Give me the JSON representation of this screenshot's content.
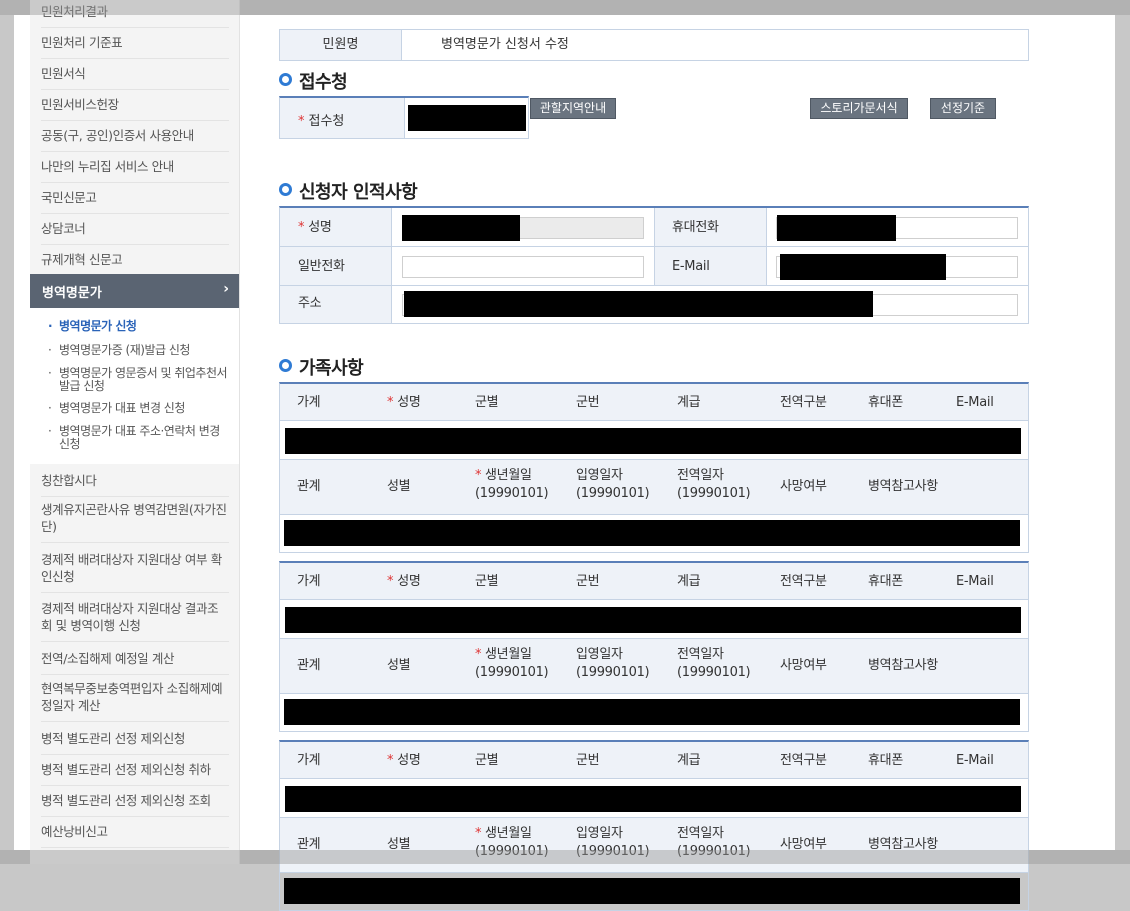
{
  "sidebar": {
    "items_top": [
      "민원처리결과",
      "민원처리 기준표",
      "민원서식",
      "민원서비스헌장",
      "공동(구, 공인)인증서 사용안내",
      "나만의 누리집 서비스 안내",
      "국민신문고",
      "상담코너",
      "규제개혁 신문고"
    ],
    "active": "병역명문가",
    "sub": [
      "병역명문가 신청",
      "병역명문가증 (재)발급 신청",
      "병역명문가 영문증서 및 취업추천서 발급 신청",
      "병역명문가 대표 변경 신청",
      "병역명문가 대표 주소·연락처 변경 신청"
    ],
    "items_bottom": [
      "칭찬합시다",
      "생계유지곤란사유 병역감면원(자가진단)",
      "경제적 배려대상자 지원대상 여부 확인신청",
      "경제적 배려대상자 지원대상 결과조회 및 병역이행 신청",
      "전역/소집해제 예정일 계산",
      "현역복무중보충역편입자 소집해제예정일자 계산",
      "병적 별도관리 선정 제외신청",
      "병적 별도관리 선정 제외신청 취하",
      "병적 별도관리 선정 제외신청 조회",
      "예산낭비신고"
    ]
  },
  "form": {
    "name_label": "민원명",
    "name_value": "병역명문가 신청서 수정",
    "receiver_title": "접수청",
    "receiver_label": "접수청",
    "btn_area": "관할지역안내",
    "btn_story": "스토리가문서식",
    "btn_criteria": "선정기준",
    "applicant_title": "신청자 인적사항",
    "lbl_name": "성명",
    "lbl_mobile": "휴대전화",
    "lbl_phone": "일반전화",
    "lbl_email": "E-Mail",
    "lbl_addr": "주소",
    "family_title": "가족사항"
  },
  "family": {
    "head1": [
      "가계",
      "성명",
      "군별",
      "군번",
      "계급",
      "전역구분",
      "휴대폰",
      "E-Mail"
    ],
    "head2": [
      "관계",
      "성별",
      "생년월일\n(19990101)",
      "입영일자\n(19990101)",
      "전역일자\n(19990101)",
      "사망여부",
      "병역참고사항"
    ],
    "required_col": "성명",
    "required_col2": "생년월일"
  }
}
